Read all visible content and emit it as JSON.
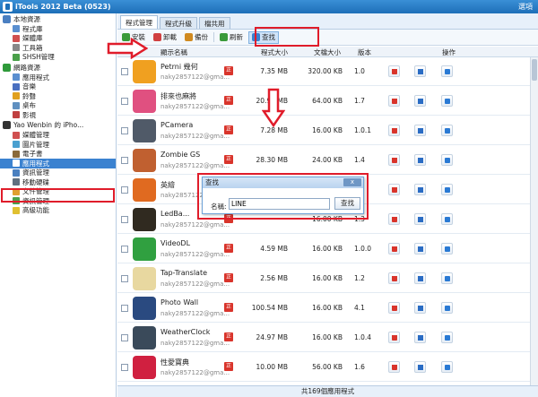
{
  "window": {
    "title": "iTools 2012 Beta (0523)",
    "options_label": "選項"
  },
  "sidebar": {
    "groups": [
      {
        "label": "本地資源",
        "color": "#4a7fc1",
        "items": [
          {
            "label": "程式庫",
            "color": "#5a8fd0"
          },
          {
            "label": "媒體庫",
            "color": "#d05050"
          },
          {
            "label": "工具箱",
            "color": "#888888"
          },
          {
            "label": "SHSH管理",
            "color": "#4aa04a"
          }
        ]
      },
      {
        "label": "網路資源",
        "color": "#2f9a3a",
        "items": [
          {
            "label": "應用程式",
            "color": "#5a8fd0"
          },
          {
            "label": "音樂",
            "color": "#4a70c0"
          },
          {
            "label": "鈴聲",
            "color": "#e0a020"
          },
          {
            "label": "桌布",
            "color": "#6090c0"
          },
          {
            "label": "影視",
            "color": "#c04040"
          }
        ]
      },
      {
        "label": "Yao Wenbin 的 iPho...",
        "color": "#333333",
        "items": [
          {
            "label": "媒體管理",
            "color": "#d05050"
          },
          {
            "label": "圖片管理",
            "color": "#4aa0d0"
          },
          {
            "label": "電子書",
            "color": "#8a6a3a"
          },
          {
            "label": "應用程式",
            "color": "#ffffff",
            "active": true
          },
          {
            "label": "資訊管理",
            "color": "#4a80c0"
          },
          {
            "label": "移動硬碟",
            "color": "#607080"
          },
          {
            "label": "文件管理",
            "color": "#e0a030"
          },
          {
            "label": "資訊管理",
            "color": "#4aa04a"
          },
          {
            "label": "高級功能",
            "color": "#e0c030"
          }
        ]
      }
    ]
  },
  "tabs": [
    {
      "label": "程式管理",
      "active": true
    },
    {
      "label": "程式升級"
    },
    {
      "label": "檔共用"
    }
  ],
  "toolbar": {
    "buttons": [
      {
        "label": "安裝",
        "color": "#3a9a3a"
      },
      {
        "label": "卸載",
        "color": "#d04040"
      },
      {
        "label": "備份",
        "color": "#d08a20"
      },
      {
        "label": "刷新",
        "color": "#3a9a3a"
      },
      {
        "label": "查找",
        "color": "#3a80d0",
        "selected": true
      }
    ]
  },
  "table": {
    "headers": {
      "name": "顯示名稱",
      "prog_size": "程式大小",
      "doc_size": "文檔大小",
      "version": "版本",
      "actions": "操作"
    },
    "badge": "正",
    "rows": [
      {
        "name": "Petrni 幾何",
        "account": "naky2857122@gma...",
        "prog_size": "7.35 MB",
        "doc_size": "320.00 KB",
        "version": "1.0",
        "icon_color": "#f0a020"
      },
      {
        "name": "排來也麻將",
        "account": "naky2857122@gma...",
        "prog_size": "20.98 MB",
        "doc_size": "64.00 KB",
        "version": "1.7",
        "icon_color": "#e05080"
      },
      {
        "name": "PCamera",
        "account": "naky2857122@gma...",
        "prog_size": "7.28 MB",
        "doc_size": "16.00 KB",
        "version": "1.0.1",
        "icon_color": "#505a68"
      },
      {
        "name": "Zombie GS",
        "account": "naky2857122@gma...",
        "prog_size": "28.30 MB",
        "doc_size": "24.00 KB",
        "version": "1.4",
        "icon_color": "#c06030"
      },
      {
        "name": "英繪",
        "account": "naky2857122@gma...",
        "prog_size": "",
        "doc_size": "",
        "version": "",
        "icon_color": "#e06a20"
      },
      {
        "name": "LedBa...",
        "account": "naky2857122@gma...",
        "prog_size": "",
        "doc_size": "16.00 KB",
        "version": "1.3",
        "icon_color": "#302a20"
      },
      {
        "name": "VideoDL",
        "account": "naky2857122@gma...",
        "prog_size": "4.59 MB",
        "doc_size": "16.00 KB",
        "version": "1.0.0",
        "icon_color": "#30a040"
      },
      {
        "name": "Tap-Translate",
        "account": "naky2857122@gma...",
        "prog_size": "2.56 MB",
        "doc_size": "16.00 KB",
        "version": "1.2",
        "icon_color": "#e8d8a0"
      },
      {
        "name": "Photo Wall",
        "account": "naky2857122@gma...",
        "prog_size": "100.54 MB",
        "doc_size": "16.00 KB",
        "version": "4.1",
        "icon_color": "#2a4a80"
      },
      {
        "name": "WeatherClock",
        "account": "naky2857122@gma...",
        "prog_size": "24.97 MB",
        "doc_size": "16.00 KB",
        "version": "1.0.4",
        "icon_color": "#3a4a5a"
      },
      {
        "name": "性愛寶典",
        "account": "naky2857122@gma...",
        "prog_size": "10.00 MB",
        "doc_size": "56.00 KB",
        "version": "1.6",
        "icon_color": "#d02040"
      }
    ]
  },
  "status": {
    "text": "共169個應用程式"
  },
  "dialog": {
    "title": "查找",
    "close_label": "x",
    "field_label": "名稱:",
    "field_value": "LINE",
    "button_label": "查找"
  },
  "highlight_color": "#e01c2a"
}
